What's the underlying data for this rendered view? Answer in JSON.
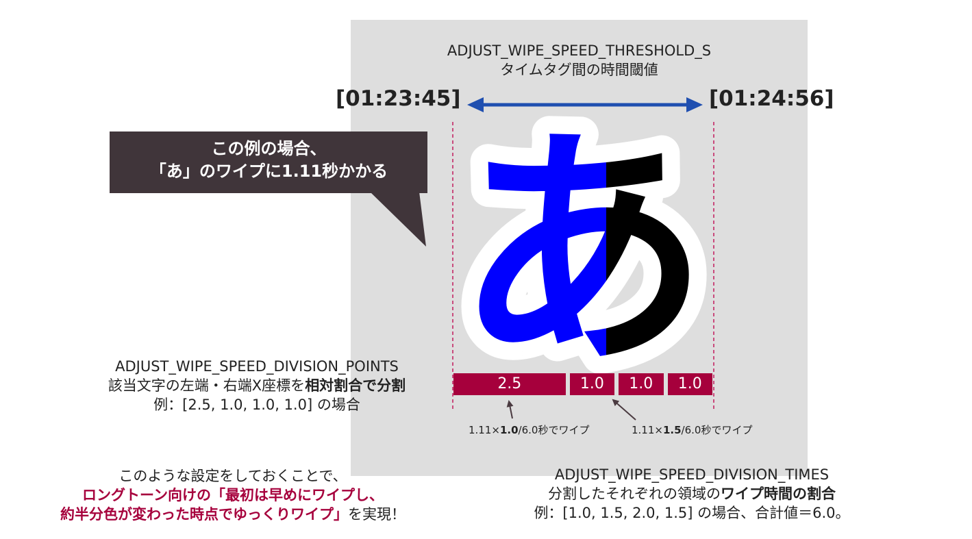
{
  "header": {
    "line1": "ADJUST_WIPE_SPEED_THRESHOLD_S",
    "line2": "タイムタグ間の時間閾値"
  },
  "timestamps": {
    "start": "[01:23:45]",
    "end": "[01:24:56]"
  },
  "callout": {
    "line1": "この例の場合、",
    "line2": "「あ」のワイプに1.11秒かかる"
  },
  "glyph": {
    "char": "あ",
    "wiped_fraction": 0.5,
    "wiped_color": "#0000ff",
    "unwiped_color": "#000000"
  },
  "segments": [
    {
      "label": "2.5",
      "weight": 2.5
    },
    {
      "label": "1.0",
      "weight": 1.0
    },
    {
      "label": "1.0",
      "weight": 1.0
    },
    {
      "label": "1.0",
      "weight": 1.0
    }
  ],
  "notes": {
    "note1_pre": "1.11×",
    "note1_bold": "1.0",
    "note1_post": "/6.0秒でワイプ",
    "note2_pre": "1.11×",
    "note2_bold": "1.5",
    "note2_post": "/6.0秒でワイプ"
  },
  "division_points": {
    "line1": "ADJUST_WIPE_SPEED_DIVISION_POINTS",
    "line2_pre": "該当文字の左端・右端X座標を",
    "line2_bold": "相対割合で分割",
    "line3": "例：[2.5, 1.0, 1.0, 1.0] の場合"
  },
  "division_times": {
    "line1": "ADJUST_WIPE_SPEED_DIVISION_TIMES",
    "line2_pre": "分割したそれぞれの領域の",
    "line2_bold": "ワイプ時間の割合",
    "line3": "例：[1.0, 1.5, 2.0, 1.5] の場合、合計値＝6.0。"
  },
  "summary": {
    "line1": "このような設定をしておくことで、",
    "line2_hl": "ロングトーン向けの「最初は早めにワイプし、",
    "line3_hl": "約半分色が変わった時点でゆっくりワイプ」",
    "line3_post": "を実現！"
  },
  "colors": {
    "accent": "#a6003c",
    "arrow": "#1f4fb0",
    "callout_bg": "#40353a",
    "panel": "#dedede"
  }
}
